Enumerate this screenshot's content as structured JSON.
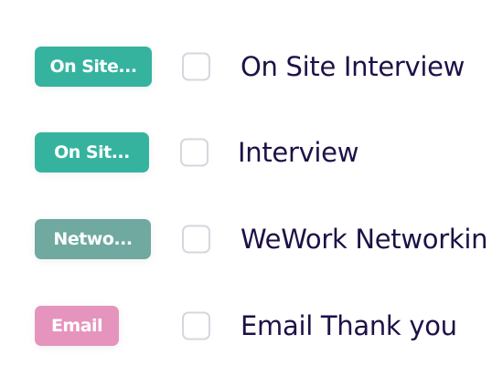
{
  "tasks": [
    {
      "tag": "On Site...",
      "tag_color": "#35b39f",
      "label": "On Site Interview"
    },
    {
      "tag": "On Sit...",
      "tag_color": "#35b39f",
      "label": "Interview"
    },
    {
      "tag": "Netwo...",
      "tag_color": "#6fa99f",
      "label": "WeWork Networkin"
    },
    {
      "tag": "Email",
      "tag_color": "#e595bd",
      "label": "Email Thank you"
    }
  ]
}
